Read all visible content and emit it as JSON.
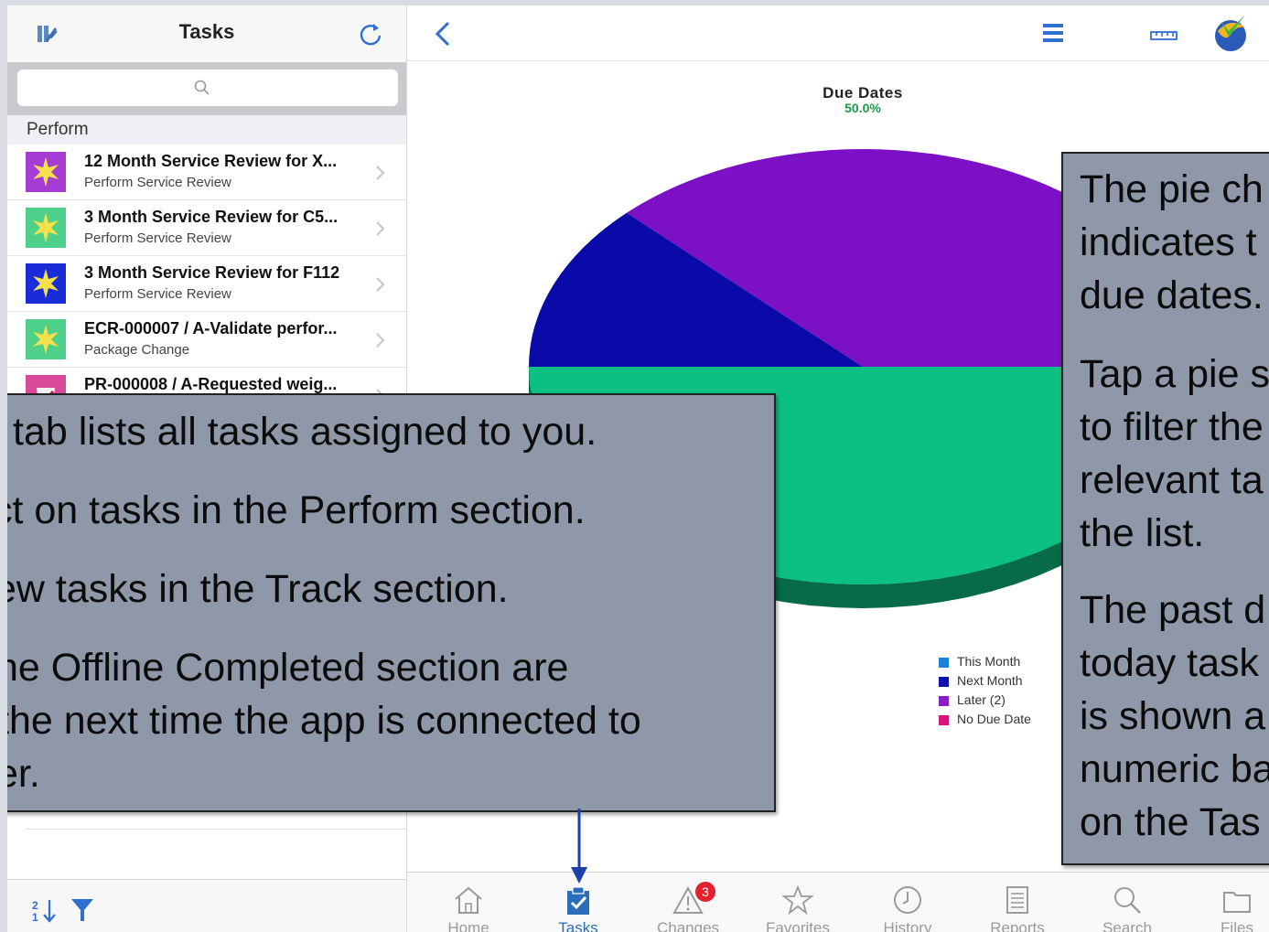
{
  "left_panel": {
    "title": "Tasks",
    "search": {
      "placeholder": ""
    },
    "section": "Perform",
    "tasks": [
      {
        "title": "12 Month Service Review for X...",
        "subtitle": "Perform Service Review",
        "thumb": "#a63cd4"
      },
      {
        "title": "3 Month Service Review for C5...",
        "subtitle": "Perform Service Review",
        "thumb": "#4ecf8a"
      },
      {
        "title": "3 Month Service Review for F112",
        "subtitle": "Perform Service Review",
        "thumb": "#1a2bd8"
      },
      {
        "title": "ECR-000007 / A-Validate perfor...",
        "subtitle": "Package Change",
        "thumb": "#4ecf8a"
      },
      {
        "title": "PR-000008 / A-Requested weig...",
        "subtitle": "",
        "thumb": "#d94b9a"
      }
    ],
    "footer_icons": [
      "sort-icon",
      "filter-icon"
    ]
  },
  "top_bar": {
    "icons": [
      "back-icon",
      "menu-icon",
      "ruler-icon",
      "app-logo-icon"
    ]
  },
  "chart_data": {
    "type": "pie",
    "title": "Due Dates",
    "highlight_percent": "50.0%",
    "legend": [
      {
        "label": "This Month",
        "color": "#1d7fd6"
      },
      {
        "label": "Next Month",
        "color": "#1010b0"
      },
      {
        "label": "Later (2)",
        "color": "#8a1cc7"
      },
      {
        "label": "No Due Date",
        "color": "#d8137a"
      }
    ],
    "slices": [
      {
        "label": "No Due Date",
        "value": 50.0,
        "color": "#0cc083"
      },
      {
        "label": "Later (2)",
        "value": 37.5,
        "color": "#7c10c4"
      },
      {
        "label": "Next Month",
        "value": 12.5,
        "color": "#0a0aa8"
      }
    ]
  },
  "tabbar": {
    "tabs": [
      {
        "label": "Home",
        "icon": "home-icon"
      },
      {
        "label": "Tasks",
        "icon": "tasks-icon",
        "active": true
      },
      {
        "label": "Changes",
        "icon": "changes-icon",
        "badge": "3"
      },
      {
        "label": "Favorites",
        "icon": "star-icon"
      },
      {
        "label": "History",
        "icon": "clock-icon"
      },
      {
        "label": "Reports",
        "icon": "reports-icon"
      },
      {
        "label": "Search",
        "icon": "search-icon"
      },
      {
        "label": "Files",
        "icon": "folder-icon"
      }
    ]
  },
  "callouts": {
    "left": {
      "line1": "tab lists all tasks assigned to you.",
      "line2": "ct on tasks in the Perform section.",
      "line3": "ew tasks in the Track section.",
      "line4": "ne Offline Completed section are",
      "line5": "the next time the app is connected to",
      "line6": "er."
    },
    "right": {
      "para1": "The pie ch\nindicates t\ndue dates.",
      "para2": "Tap a pie s\nto filter the\nrelevant ta\nthe list.",
      "para3": "The past d\ntoday task\nis shown a\nnumeric ba\non the Tas"
    }
  }
}
